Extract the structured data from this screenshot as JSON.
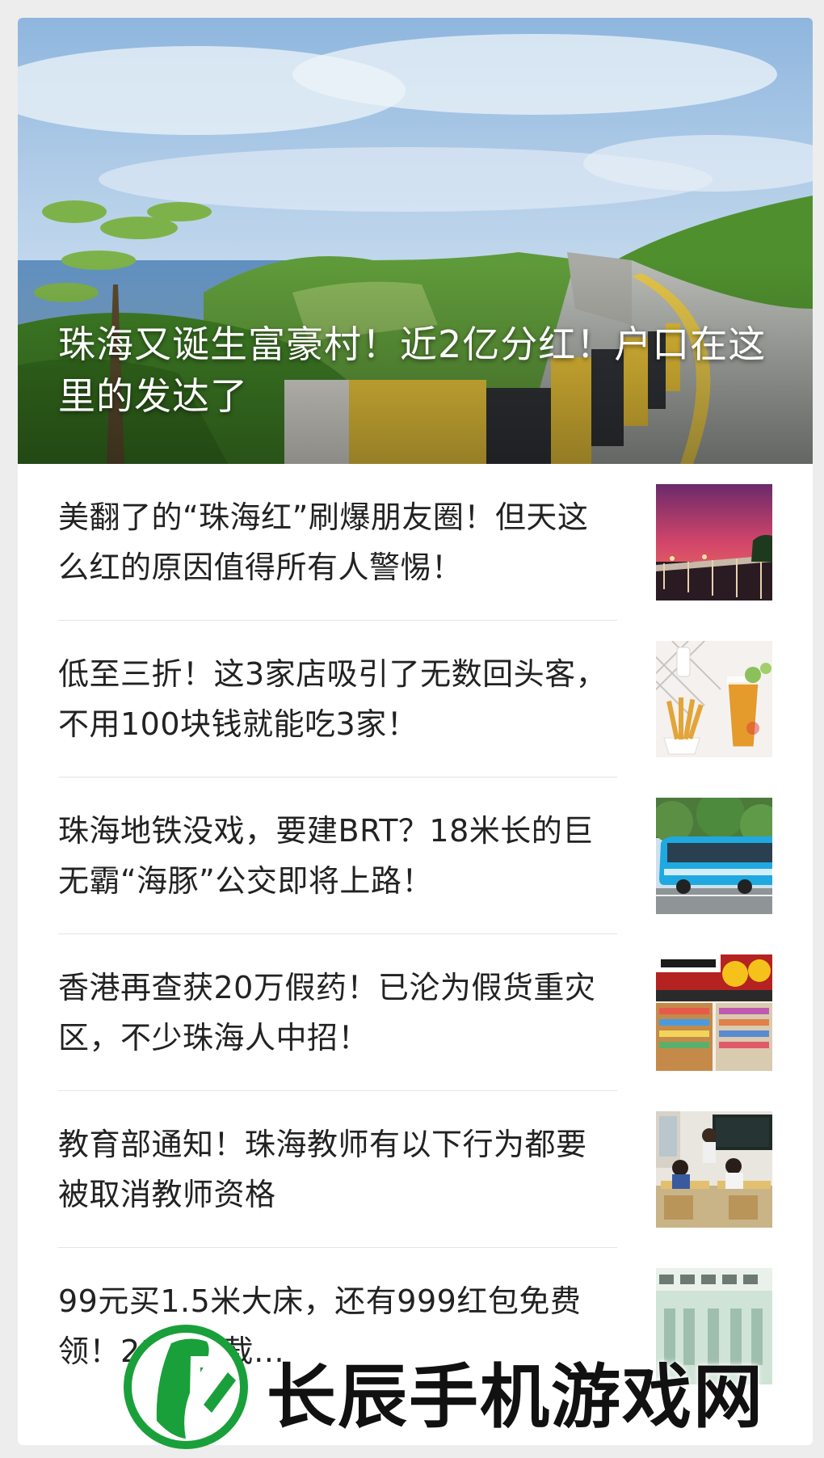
{
  "hero": {
    "title": "珠海又诞生富豪村！近2亿分红！户口在这里的发达了"
  },
  "articles": [
    {
      "title": "美翻了的“珠海红”刷爆朋友圈！但天这么红的原因值得所有人警惕！",
      "thumb": "sunset-bridge"
    },
    {
      "title": "低至三折！这3家店吸引了无数回头客，不用100块钱就能吃3家！",
      "thumb": "fries-and-drink"
    },
    {
      "title": "珠海地铁没戏，要建BRT？18米长的巨无霸“海豚”公交即将上路！",
      "thumb": "blue-bus"
    },
    {
      "title": "香港再查获20万假药！已沦为假货重灾区，不少珠海人中招！",
      "thumb": "hk-pharmacy"
    },
    {
      "title": "教育部通知！珠海教师有以下行为都要被取消教师资格",
      "thumb": "classroom"
    },
    {
      "title": "99元买1.5米大床，还有999红包免费领！21美食截…",
      "thumb": "calendar-sign"
    }
  ],
  "watermark": {
    "text": "长辰手机游戏网"
  },
  "colors": {
    "page_bg": "#ededed",
    "card_bg": "#ffffff",
    "title_text": "#222222",
    "divider": "#e4e4e4",
    "watermark_green": "#19a03a"
  }
}
